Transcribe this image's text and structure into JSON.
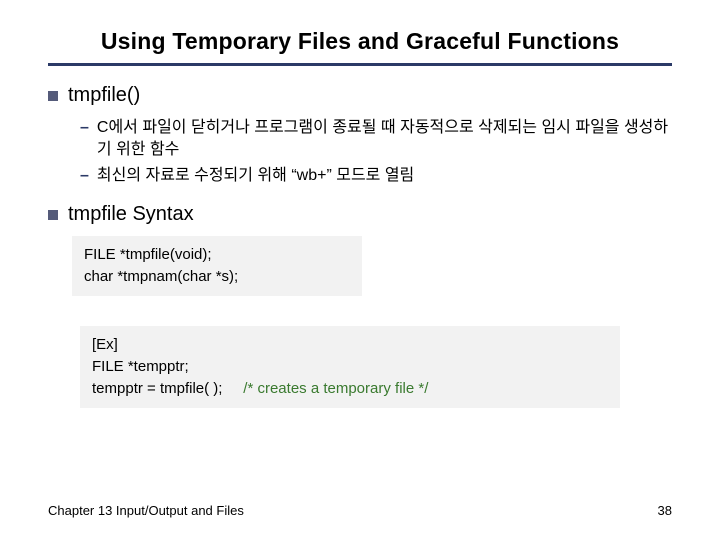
{
  "title": "Using Temporary Files and Graceful Functions",
  "sec1": {
    "heading": "tmpfile()",
    "bullet1": "C에서 파일이 닫히거나 프로그램이 종료될 때 자동적으로 삭제되는 임시 파일을 생성하기 위한 함수",
    "bullet2": "최신의 자료로 수정되기 위해 “wb+” 모드로 열림"
  },
  "sec2": {
    "heading": "tmpfile Syntax",
    "code_line1": "FILE *tmpfile(void);",
    "code_line2": "char *tmpnam(char *s);"
  },
  "example": {
    "line1": "[Ex]",
    "line2": "FILE *tempptr;",
    "line3a": "tempptr = tmpfile( );",
    "line3b": "/* creates a temporary file */"
  },
  "footer": {
    "left": "Chapter 13  Input/Output and Files",
    "right": "38"
  }
}
